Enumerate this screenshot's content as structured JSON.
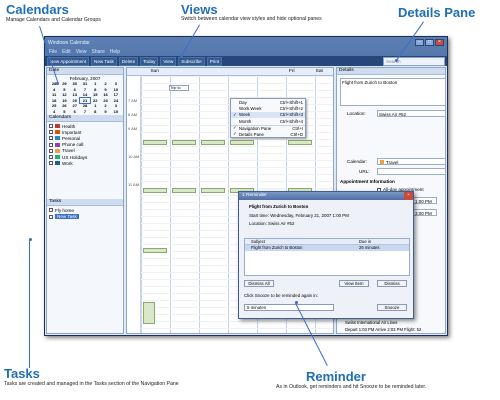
{
  "callouts": {
    "calendars": {
      "title": "Calendars",
      "desc": "Manage Calendars and Calendar Groups"
    },
    "views": {
      "title": "Views",
      "desc": "Switch between calendar view styles and hide optional panes"
    },
    "details": {
      "title": "Details Pane"
    },
    "tasks": {
      "title": "Tasks",
      "desc": "Tasks are created and managed in the Tasks section of the Navigation Pane"
    },
    "reminder": {
      "title": "Reminder",
      "desc": "As in Outlook, get reminders and hit Snooze to be reminded later."
    }
  },
  "window": {
    "title": "Windows Calendar",
    "menu": [
      "File",
      "Edit",
      "View",
      "Share",
      "Help"
    ],
    "toolbar": {
      "new_appointment": "New Appointment",
      "new_task": "New Task",
      "delete": "Delete",
      "today": "Today",
      "view": "View",
      "subscribe": "Subscribe",
      "print": "Print",
      "search_placeholder": "Search"
    }
  },
  "nav": {
    "date_header": "Date",
    "month_label": "February, 2007",
    "weeks": [
      [
        "28",
        "29",
        "30",
        "31",
        "1",
        "2",
        "3"
      ],
      [
        "4",
        "5",
        "6",
        "7",
        "8",
        "9",
        "10"
      ],
      [
        "11",
        "12",
        "13",
        "14",
        "15",
        "16",
        "17"
      ],
      [
        "18",
        "19",
        "20",
        "21",
        "22",
        "23",
        "24"
      ],
      [
        "25",
        "26",
        "27",
        "28",
        "1",
        "2",
        "3"
      ],
      [
        "4",
        "5",
        "6",
        "7",
        "8",
        "9",
        "10"
      ]
    ],
    "calendars_header": "Calendars",
    "calendars": [
      {
        "label": "Health",
        "color": "#c0392b"
      },
      {
        "label": "Important",
        "color": "#d35400"
      },
      {
        "label": "Personal",
        "color": "#2e86c1"
      },
      {
        "label": "Phone call",
        "color": "#8e44ad"
      },
      {
        "label": "Travel",
        "color": "#e9a23b"
      },
      {
        "label": "US Holidays",
        "color": "#27ae60"
      },
      {
        "label": "Work",
        "color": "#1f618d"
      }
    ],
    "tasks_header": "Tasks",
    "tasks": [
      "Fly home",
      "New Task"
    ]
  },
  "main": {
    "days": [
      "Sun",
      "",
      "",
      "",
      "",
      "Fri",
      "Sat"
    ],
    "times": [
      "7 AM",
      "8 AM",
      "9 AM",
      "10 AM",
      "11 AM"
    ],
    "trip_label": "Trip to"
  },
  "view_menu": {
    "items": [
      {
        "label": "Day",
        "shortcut": "Ctrl+Shift+1",
        "checked": false
      },
      {
        "label": "Work Week",
        "shortcut": "Ctrl+Shift+2",
        "checked": false
      },
      {
        "label": "Week",
        "shortcut": "Ctrl+Shift+3",
        "checked": true
      },
      {
        "label": "Month",
        "shortcut": "Ctrl+Shift+4",
        "checked": false
      },
      {
        "label": "Navigation Pane",
        "shortcut": "Ctrl+I",
        "checked": true
      },
      {
        "label": "Details Pane",
        "shortcut": "Ctrl+D",
        "checked": true
      }
    ]
  },
  "details": {
    "header": "Details",
    "subject": "Flight from Zurich to Boston",
    "location_label": "Location:",
    "location": "Swiss Air #52",
    "calendar_label": "Calendar:",
    "calendar": "Travel",
    "url_label": "URL:",
    "appt_info": "Appointment Information",
    "all_day": "All-day appointment",
    "start_label": "Start:",
    "start_date": "2/21/2007",
    "start_time": "1:00 PM",
    "end_label": "End:",
    "end_date": "2/21/2007",
    "end_time": "3:00 PM",
    "notes": [
      "Swiss International Air Lines",
      "Depart 1:03 PM Arrive 2:03 PM Flight: 52"
    ]
  },
  "reminder": {
    "title": "1 Reminder",
    "subject": "Flight from Zurich to Boston",
    "start": "Start time: Wednesday, February 21, 2007 1:00 PM",
    "location": "Location: Swiss Air #52",
    "col_subject": "Subject",
    "col_due": "Due in",
    "row_subject": "Flight from Zurich to Boston",
    "row_due": "26 minutes",
    "dismiss_all": "Dismiss All",
    "view_item": "View Item",
    "dismiss": "Dismiss",
    "snooze_prompt": "Click Snooze to be reminded again in:",
    "snooze_value": "5 minutes",
    "snooze": "Snooze"
  }
}
